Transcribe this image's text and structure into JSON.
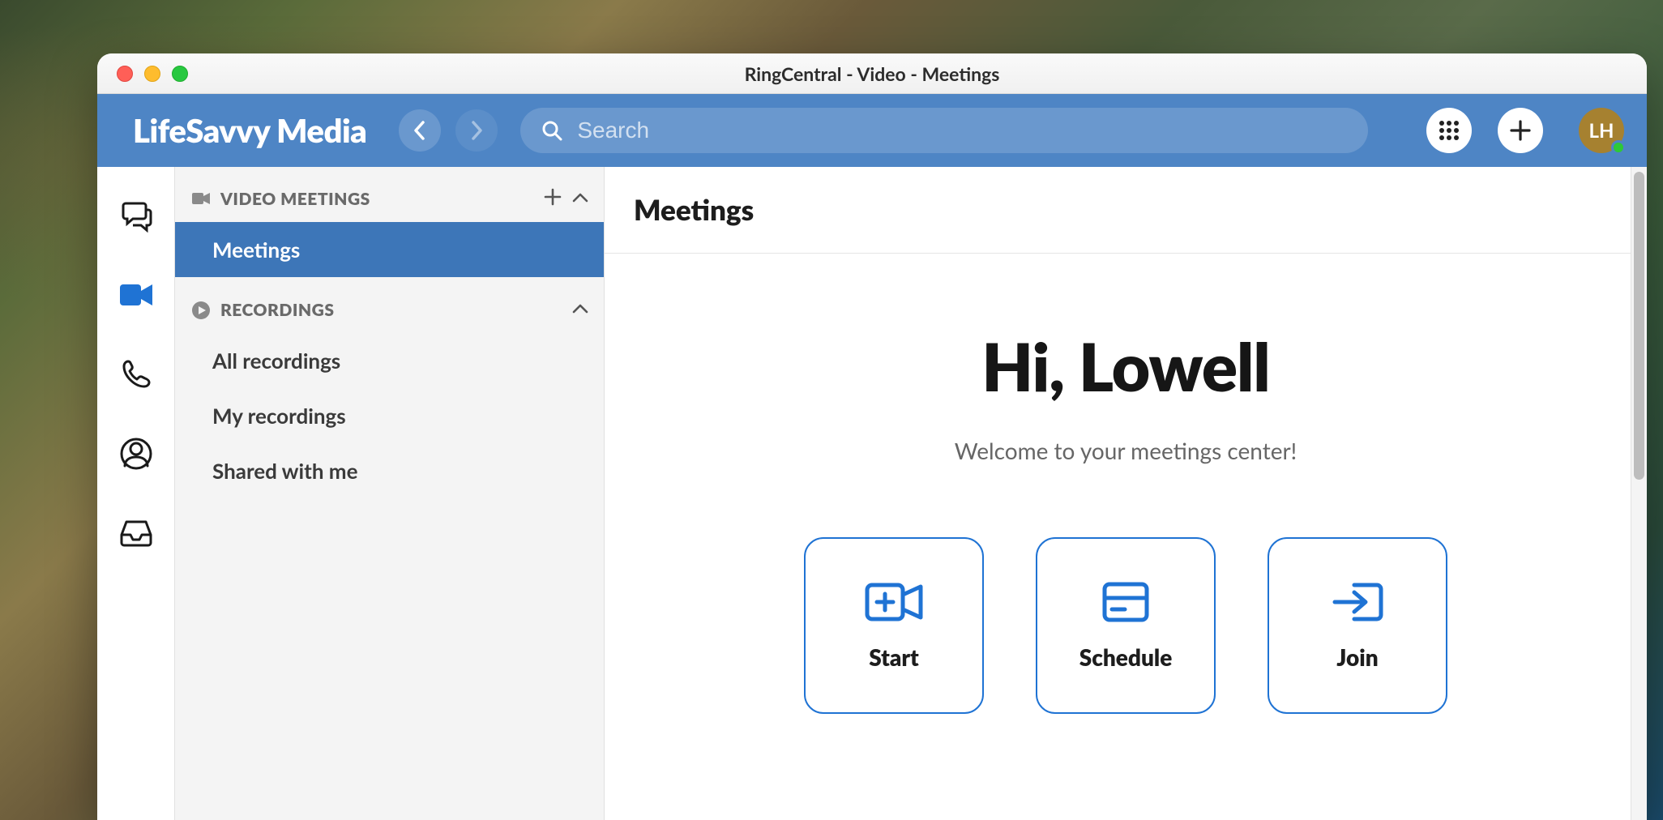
{
  "window": {
    "title": "RingCentral - Video - Meetings"
  },
  "header": {
    "org_name": "LifeSavvy Media",
    "search_placeholder": "Search",
    "avatar_initials": "LH"
  },
  "iconrail": {
    "items": [
      {
        "name": "messages"
      },
      {
        "name": "video",
        "active": true
      },
      {
        "name": "phone"
      },
      {
        "name": "contacts"
      },
      {
        "name": "inbox"
      }
    ]
  },
  "sidepanel": {
    "sections": [
      {
        "label": "VIDEO MEETINGS",
        "show_add": true,
        "items": [
          {
            "label": "Meetings",
            "active": true
          }
        ]
      },
      {
        "label": "RECORDINGS",
        "show_add": false,
        "items": [
          {
            "label": "All recordings"
          },
          {
            "label": "My recordings"
          },
          {
            "label": "Shared with me"
          }
        ]
      }
    ]
  },
  "main": {
    "title": "Meetings",
    "greeting": "Hi, Lowell",
    "welcome": "Welcome to your meetings center!",
    "actions": [
      {
        "label": "Start",
        "icon": "start"
      },
      {
        "label": "Schedule",
        "icon": "schedule"
      },
      {
        "label": "Join",
        "icon": "join"
      }
    ]
  }
}
